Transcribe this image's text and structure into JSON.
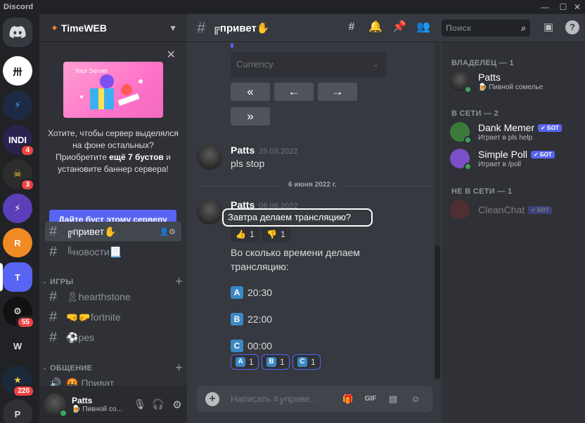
{
  "app": {
    "title": "Discord",
    "window_controls": [
      "—",
      "☐",
      "✕"
    ]
  },
  "servers": [
    {
      "abbr": "卅",
      "color": "#ffffff",
      "text_color": "#000000"
    },
    {
      "abbr": "⚡",
      "color": "#1e2a44",
      "text_color": "#3fa9f5"
    },
    {
      "abbr": "INDI",
      "color": "#2b2250",
      "text_color": "#ffffff",
      "badge": "4"
    },
    {
      "abbr": "☠",
      "color": "#2d2d2d",
      "text_color": "#ffcc33",
      "badge": "3"
    },
    {
      "abbr": "⚡",
      "color": "#5b3fb8",
      "text_color": "#ffffff"
    },
    {
      "abbr": "R",
      "color": "#f08a24",
      "text_color": "#ffffff"
    },
    {
      "abbr": "T",
      "color": "#5865f2",
      "text_color": "#ffffff"
    },
    {
      "abbr": "⚙",
      "color": "#111111",
      "text_color": "#ffffff",
      "badge": "55"
    },
    {
      "abbr": "W",
      "color": "#202225",
      "text_color": "#dcddde"
    },
    {
      "abbr": "★",
      "color": "#1b2a3a",
      "text_color": "#f5c542",
      "badge": "220"
    },
    {
      "abbr": "P",
      "color": "#2f3136",
      "text_color": "#dcddde"
    }
  ],
  "guild": {
    "name": "TimeWEB",
    "boost": {
      "image_label": "Your Server",
      "text_part1": "Хотите, чтобы сервер выделялся на фоне остальных? Приобретите ",
      "text_bold": "ещё 7 бустов",
      "text_part2": " и установите баннер сервера!",
      "button": "Дайте буст этому серверу"
    },
    "channels_top": [
      {
        "name": "╔привет✋",
        "active": true
      },
      {
        "name": "╚новости📃",
        "active": false
      }
    ],
    "categories": [
      {
        "name": "ИГРЫ",
        "channels": [
          "🎗hearthstone",
          "🤜🤛fortnite",
          "⚽pes"
        ]
      },
      {
        "name": "ОБЩЕНИЕ",
        "channels": [
          "🤬 Приват"
        ]
      }
    ]
  },
  "user": {
    "name": "Patts",
    "status": "🍺 Пивной со..."
  },
  "chat": {
    "channel": "╔привет✋",
    "search_placeholder": "Поиск",
    "select_placeholder": "Currency",
    "buttons_row1": [
      "«",
      "←",
      "→"
    ],
    "buttons_row2": [
      "»"
    ],
    "messages": [
      {
        "author": "Patts",
        "timestamp": "25.03.2022",
        "text": "pls stop"
      }
    ],
    "date_divider": "6 июня 2022 г.",
    "message2": {
      "author": "Patts",
      "timestamp": "06.06.2022",
      "highlighted": "Завтра делаем трансляцию?",
      "reactions": [
        {
          "emoji": "👍",
          "count": "1"
        },
        {
          "emoji": "👎",
          "count": "1"
        }
      ],
      "question_l1": "Во сколько времени делаем",
      "question_l2": "трансляцию:",
      "options": [
        {
          "letter": "A",
          "time": "20:30"
        },
        {
          "letter": "B",
          "time": "22:00"
        },
        {
          "letter": "C",
          "time": "00:00"
        }
      ],
      "poll_reactions": [
        {
          "letter": "A",
          "count": "1"
        },
        {
          "letter": "B",
          "count": "1"
        },
        {
          "letter": "C",
          "count": "1"
        }
      ]
    },
    "composer_placeholder": "Написать #╔приве..."
  },
  "members": {
    "owner_header": "ВЛАДЕЛЕЦ — 1",
    "online_header": "В СЕТИ — 2",
    "offline_header": "НЕ В СЕТИ — 1",
    "owner": {
      "name": "Patts",
      "status": "🍺 Пивной сомелье"
    },
    "online": [
      {
        "name": "Dank Memer",
        "bot": "✔ БОТ",
        "activity": "Играет в pls help",
        "color": "#3b7a3a"
      },
      {
        "name": "Simple Poll",
        "bot": "✔ БОТ",
        "activity": "Играет в /poll",
        "color": "#7b4fc7"
      }
    ],
    "offline": [
      {
        "name": "CleanChat",
        "bot": "✔ БОТ",
        "color": "#8a2d2d"
      }
    ]
  }
}
